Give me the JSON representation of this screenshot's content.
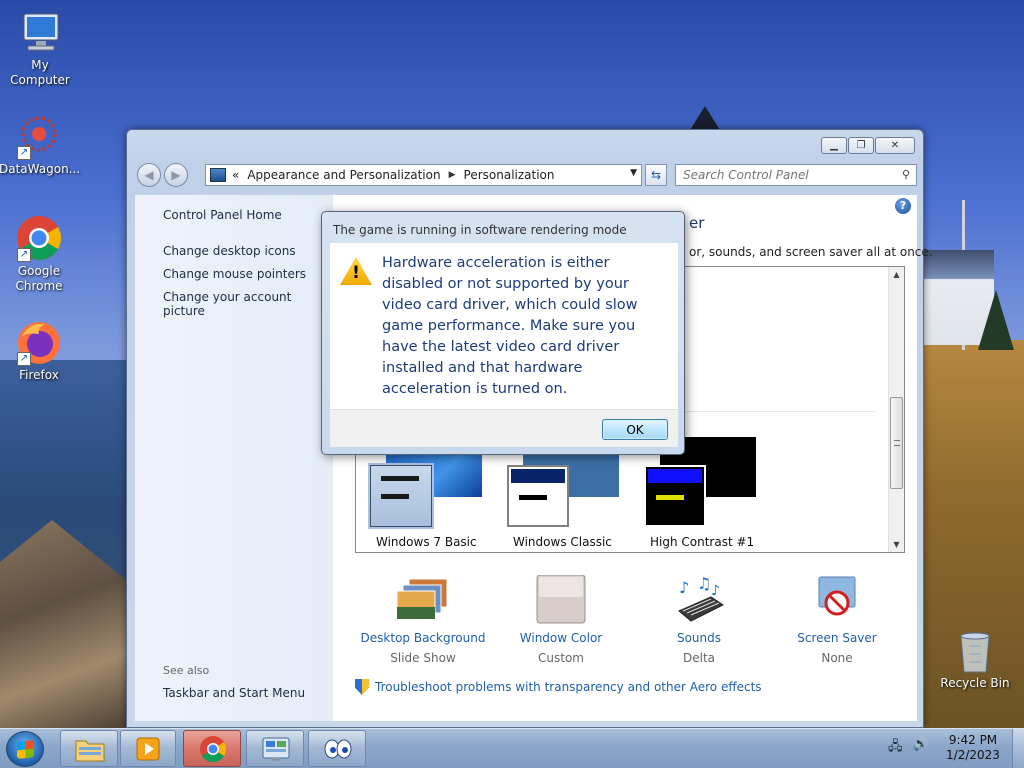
{
  "desktop": {
    "icons": [
      {
        "label": "My Computer"
      },
      {
        "label": "DataWagon..."
      },
      {
        "label": "Google Chrome"
      },
      {
        "label": "Firefox"
      },
      {
        "label": "Recycle Bin"
      }
    ]
  },
  "control_panel": {
    "address": {
      "overflow": "«",
      "crumbs": [
        "Appearance and Personalization",
        "Personalization"
      ]
    },
    "search": {
      "placeholder": "Search Control Panel"
    },
    "left_pane": {
      "links": [
        "Control Panel Home",
        "Change desktop icons",
        "Change mouse pointers",
        "Change your account picture"
      ],
      "see_also": "See also",
      "see_also_links": [
        "Taskbar and Start Menu"
      ]
    },
    "title_fragment": "er",
    "desc_fragment": "or, sounds, and screen saver all at once.",
    "themes": [
      "Windows 7 Basic",
      "Windows Classic",
      "High Contrast #1"
    ],
    "settings": [
      {
        "title": "Desktop Background",
        "sub": "Slide Show"
      },
      {
        "title": "Window Color",
        "sub": "Custom"
      },
      {
        "title": "Sounds",
        "sub": "Delta"
      },
      {
        "title": "Screen Saver",
        "sub": "None"
      }
    ],
    "troubleshoot": "Troubleshoot problems with transparency and other Aero effects"
  },
  "dialog": {
    "title": "The game is running in software rendering mode",
    "message": "Hardware acceleration is either disabled or not supported by your video card driver, which could slow game performance. Make sure you have the latest video card driver installed and that hardware acceleration is turned on.",
    "ok_label": "OK"
  },
  "taskbar": {
    "time": "9:42 PM",
    "date": "1/2/2023"
  }
}
